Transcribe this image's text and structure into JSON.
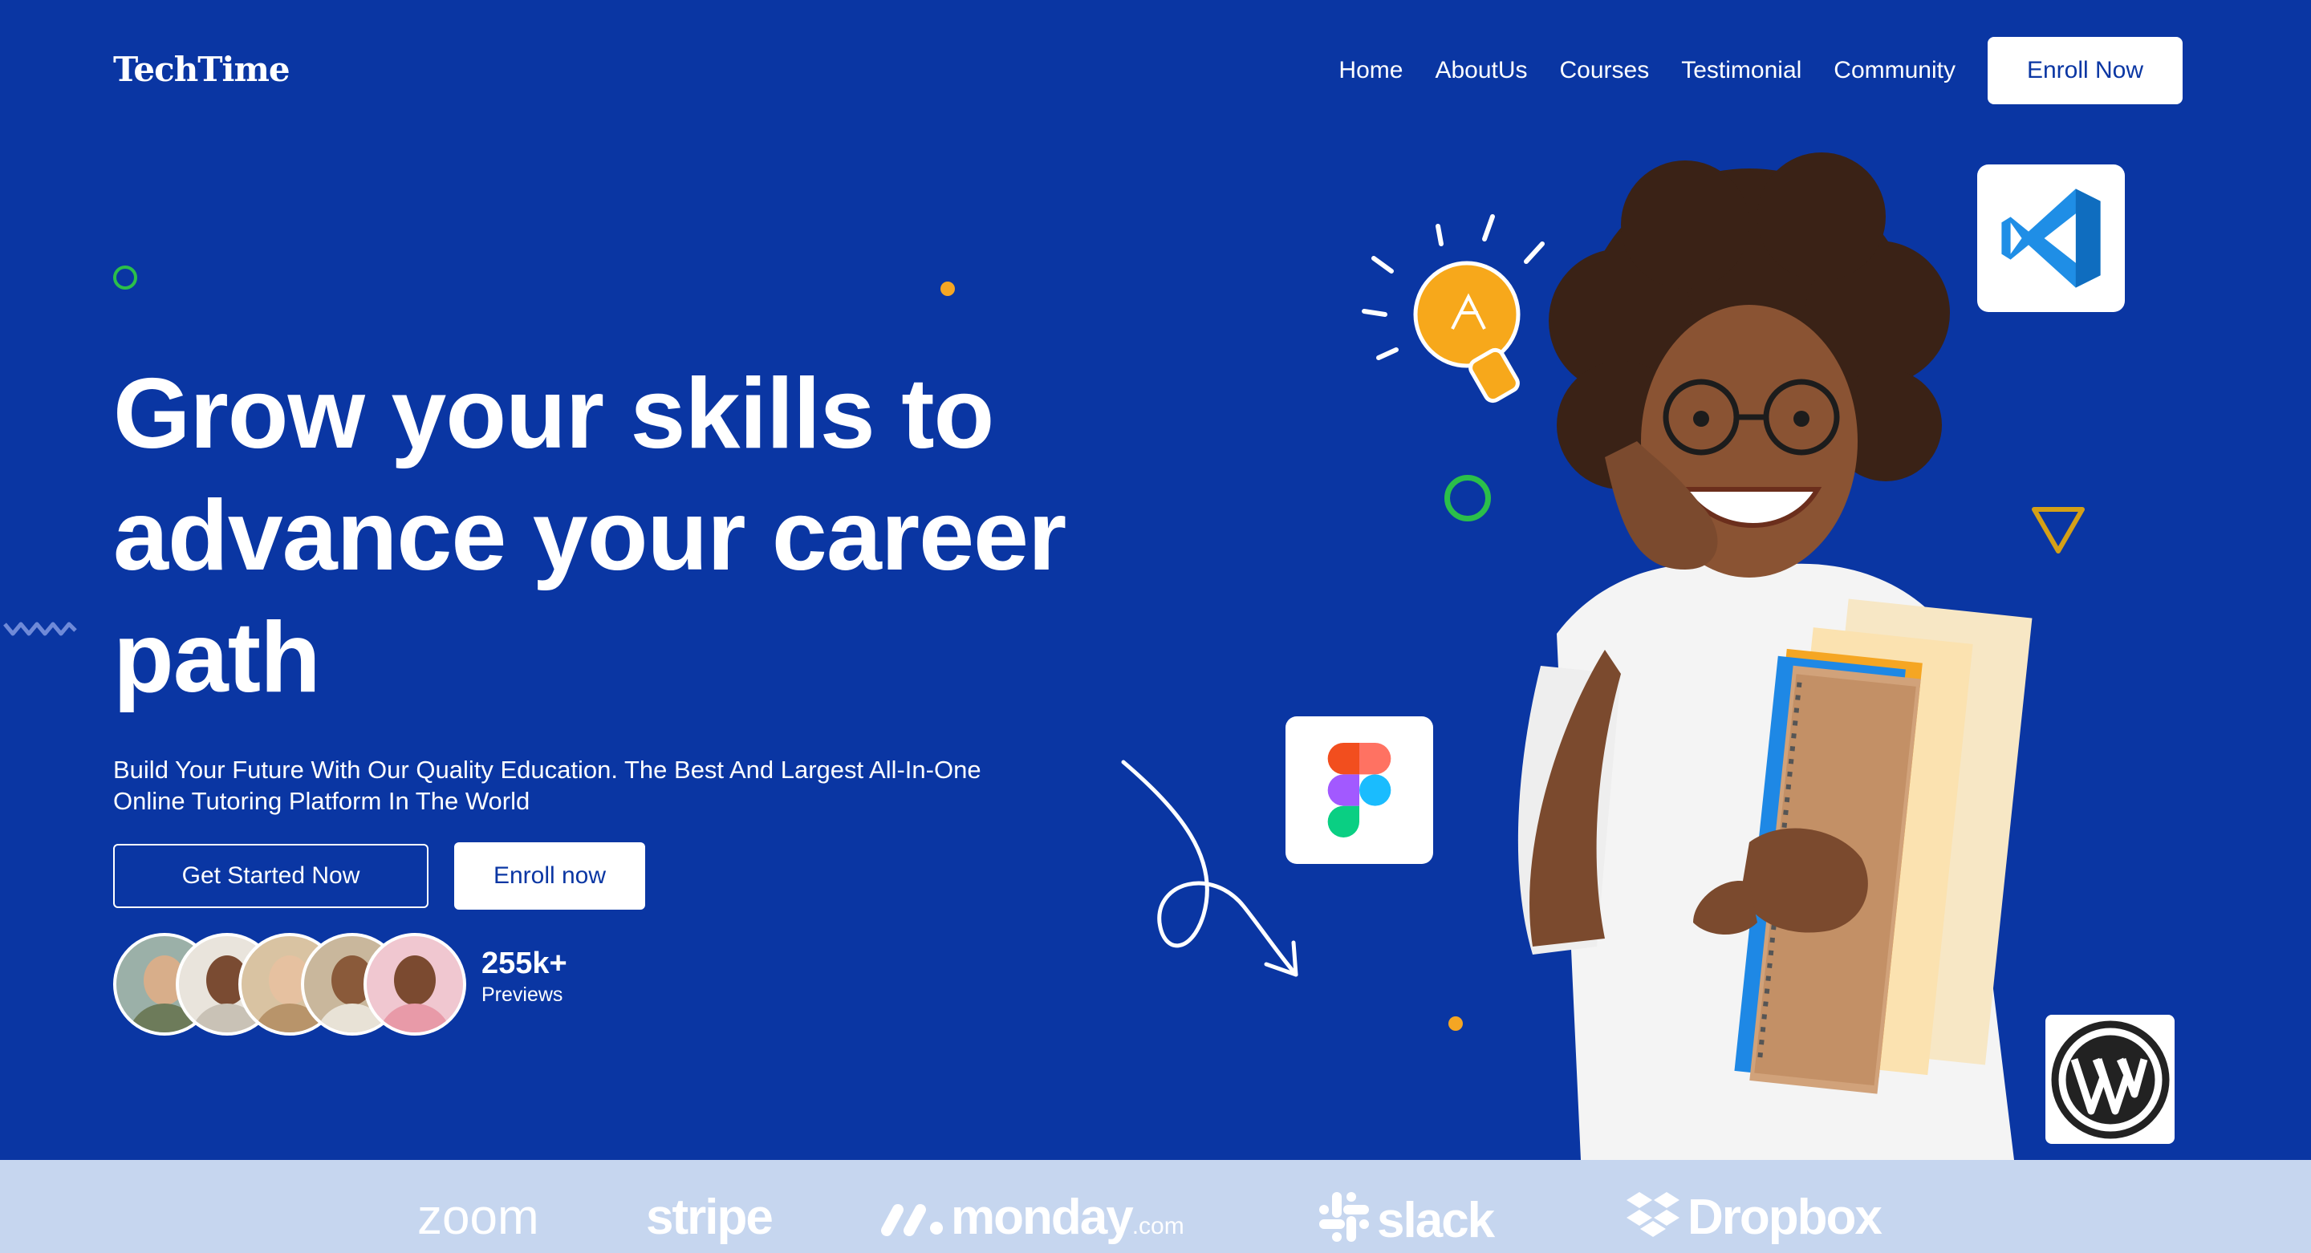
{
  "header": {
    "logo": "TechTime",
    "nav": [
      {
        "label": "Home"
      },
      {
        "label": "AboutUs"
      },
      {
        "label": "Courses"
      },
      {
        "label": "Testimonial"
      },
      {
        "label": "Community"
      }
    ],
    "cta_label": "Enroll Now"
  },
  "hero": {
    "headline_lines": [
      "Grow your skills to",
      "advance your career",
      "path"
    ],
    "subtitle_lines": [
      "Build Your Future With Our Quality Education. The Best And Largest All-In-One",
      "Online Tutoring Platform In The World"
    ],
    "primary_button": "Get Started Now",
    "secondary_button": "Enroll now",
    "stat_value": "255k+",
    "stat_label": "Previews"
  },
  "app_icons": [
    "vscode-icon",
    "figma-icon",
    "wordpress-icon"
  ],
  "brands": {
    "zoom": "zoom",
    "stripe": "stripe",
    "monday": "monday",
    "monday_suffix": ".com",
    "slack": "slack",
    "dropbox": "Dropbox"
  },
  "colors": {
    "background": "#0a36a3",
    "brand_strip": "#c6d6ef",
    "accent_green": "#2bbf4a",
    "accent_orange": "#f5a623",
    "triangle": "#d4a017"
  }
}
